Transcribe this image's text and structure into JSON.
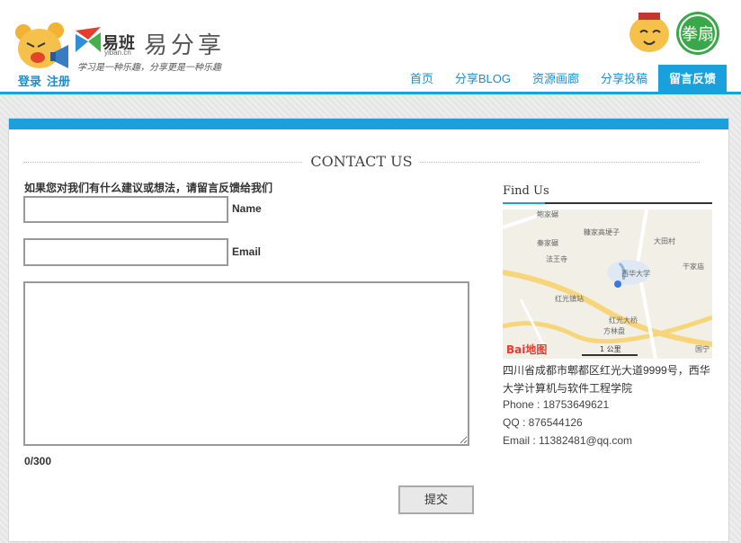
{
  "header": {
    "logo_text": "易班",
    "logo_sub": "yiban.cn",
    "site_title": "易分享",
    "slogan": "学习是一种乐趣，分享更是一种乐趣",
    "auth": {
      "login": "登录",
      "register": "注册"
    }
  },
  "nav": [
    {
      "label": "首页",
      "active": false
    },
    {
      "label": "分享BLOG",
      "active": false
    },
    {
      "label": "资源画廊",
      "active": false
    },
    {
      "label": "分享投稿",
      "active": false
    },
    {
      "label": "留言反馈",
      "active": true
    }
  ],
  "contact": {
    "title": "CONTACT US",
    "prompt": "如果您对我们有什么建议或想法，请留言反馈给我们",
    "name_label": "Name",
    "email_label": "Email",
    "name_value": "",
    "email_value": "",
    "message_value": "",
    "counter": "0/300",
    "submit_label": "提交"
  },
  "find": {
    "title": "Find Us",
    "address": "四川省成都市郫都区红光大道9999号，西华大学计算机与软件工程学院",
    "phone": "Phone : 18753649621",
    "qq": "QQ : 876544126",
    "email": "Email : 11382481@qq.com",
    "map_labels": {
      "l1": "鲍家碾",
      "l2": "糠家高埂子",
      "l3": "秦家碾",
      "l4": "大田村",
      "l5": "法王寺",
      "l6": "西华大学",
      "l7": "干家庙",
      "l8": "红光镇站",
      "l9": "红光大桥",
      "l10": "方林盘",
      "l11": "国宁",
      "scale": "1 公里",
      "brand": "Bai地图"
    }
  },
  "colors": {
    "accent": "#1aa0dc",
    "link": "#1a8fd0"
  }
}
